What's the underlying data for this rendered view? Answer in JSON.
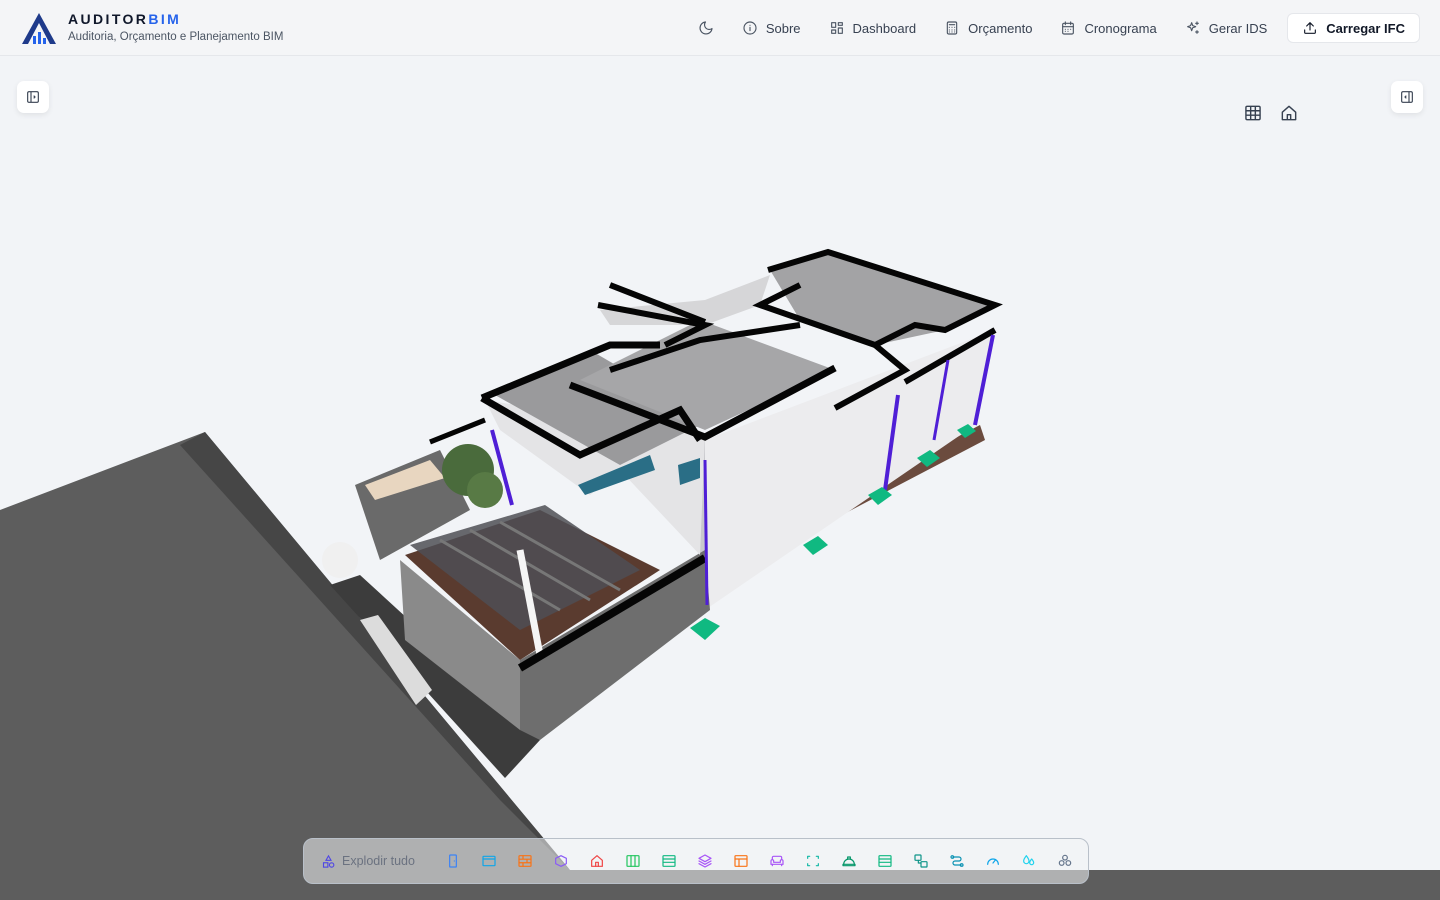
{
  "app": {
    "name_main": "AUDITOR",
    "name_accent": "BIM",
    "subtitle": "Auditoria, Orçamento e Planejamento BIM"
  },
  "nav": {
    "about": "Sobre",
    "dashboard": "Dashboard",
    "budget": "Orçamento",
    "schedule": "Cronograma",
    "ids": "Gerar IDS",
    "upload": "Carregar IFC"
  },
  "toolbar": {
    "explode_label": "Explodir tudo",
    "tools": [
      {
        "icon": "door-icon",
        "color": "#3b82f6"
      },
      {
        "icon": "window-icon",
        "color": "#0ea5e9"
      },
      {
        "icon": "wall-brick-icon",
        "color": "#f97316"
      },
      {
        "icon": "beam-icon",
        "color": "#8b5cf6"
      },
      {
        "icon": "roof-house-icon",
        "color": "#ef4444"
      },
      {
        "icon": "columns-icon",
        "color": "#22c55e"
      },
      {
        "icon": "slab-icon",
        "color": "#10b981"
      },
      {
        "icon": "layers-icon",
        "color": "#a855f7"
      },
      {
        "icon": "layout-panel-icon",
        "color": "#f97316"
      },
      {
        "icon": "sofa-furniture-icon",
        "color": "#a855f7"
      },
      {
        "icon": "space-bounds-icon",
        "color": "#14b8a6"
      },
      {
        "icon": "helmet-icon",
        "color": "#059669"
      },
      {
        "icon": "stairs-icon",
        "color": "#10b981"
      },
      {
        "icon": "ramp-shapes-icon",
        "color": "#0d9488"
      },
      {
        "icon": "pipe-route-icon",
        "color": "#0891b2"
      },
      {
        "icon": "gauge-icon",
        "color": "#0ea5e9"
      },
      {
        "icon": "water-drops-icon",
        "color": "#22d3ee"
      },
      {
        "icon": "cluster-icon",
        "color": "#64748b"
      }
    ]
  },
  "colors": {
    "brand_accent": "#2563eb",
    "background": "#f2f4f7"
  }
}
